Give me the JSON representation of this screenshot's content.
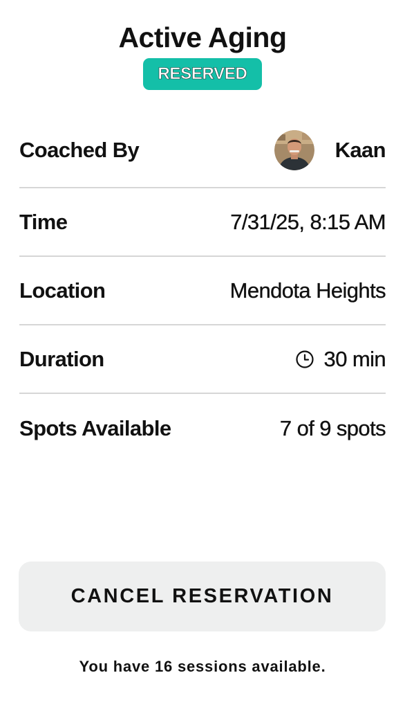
{
  "class": {
    "title": "Active Aging",
    "status_badge": "RESERVED"
  },
  "details": [
    {
      "label": "Coached By",
      "value": "Kaan",
      "icon": "coach-avatar"
    },
    {
      "label": "Time",
      "value": "7/31/25, 8:15 AM"
    },
    {
      "label": "Location",
      "value": "Mendota Heights"
    },
    {
      "label": "Duration",
      "value": "30 min",
      "icon": "clock-icon"
    },
    {
      "label": "Spots Available",
      "value": "7 of 9 spots"
    }
  ],
  "actions": {
    "cancel_label": "CANCEL RESERVATION"
  },
  "footer": {
    "sessions_note": "You have 16 sessions available."
  },
  "colors": {
    "badge_background": "#14bfa8",
    "button_background": "#eeefef",
    "divider": "#d6d6d6"
  }
}
